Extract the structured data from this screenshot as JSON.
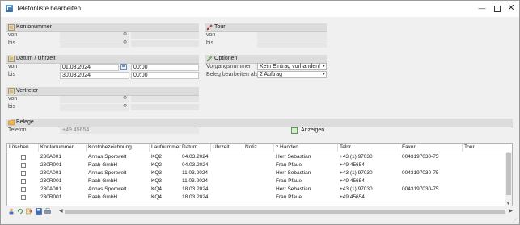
{
  "window": {
    "title": "Telefonliste bearbeiten",
    "min": "—",
    "close": "✕"
  },
  "groups": {
    "kontonummer": {
      "title": "Kontonummer",
      "von": "von",
      "bis": "bis"
    },
    "tour": {
      "title": "Tour",
      "von": "von",
      "bis": "bis"
    },
    "datum": {
      "title": "Datum / Uhrzeit",
      "von": "von",
      "bis": "bis",
      "von_date": "01.03.2024",
      "von_time": "00:00",
      "bis_date": "30.03.2024",
      "bis_time": "00:00"
    },
    "optionen": {
      "title": "Optionen",
      "vorgang_label": "Vorgangsnummer",
      "vorgang_value": "Kein Eintrag vorhanden!",
      "beleg_label": "Beleg bearbeiten als",
      "beleg_value": "2 Auftrag"
    },
    "vertreter": {
      "title": "Vertreter",
      "von": "von",
      "bis": "bis"
    },
    "belege": {
      "title": "Belege",
      "telefon_label": "Telefon",
      "telefon_value": "+49 45654"
    }
  },
  "anzeigen_label": "Anzeigen",
  "table": {
    "columns": [
      "Löschen",
      "Kontonummer",
      "Kontobezeichnung",
      "Laufnummer",
      "Datum",
      "Uhrzeit",
      "Notiz",
      "z.Handen",
      "Telnr.",
      "Faxnr.",
      "Tour"
    ],
    "rows": [
      {
        "konto": "230A001",
        "bez": "Annas Sportwelt",
        "lauf": "KQ2",
        "datum": "04.03.2024",
        "uhrzeit": "",
        "notiz": "",
        "zh": "Herr Sebastian",
        "tel": "+43 (1) 97030",
        "fax": "0043197030-75",
        "tour": ""
      },
      {
        "konto": "230R001",
        "bez": "Raab GmbH",
        "lauf": "KQ2",
        "datum": "04.03.2024",
        "uhrzeit": "",
        "notiz": "",
        "zh": "Frau Pfaue",
        "tel": "+49 45654",
        "fax": "",
        "tour": ""
      },
      {
        "konto": "230A001",
        "bez": "Annas Sportwelt",
        "lauf": "KQ3",
        "datum": "11.03.2024",
        "uhrzeit": "",
        "notiz": "",
        "zh": "Herr Sebastian",
        "tel": "+43 (1) 97030",
        "fax": "0043197030-75",
        "tour": ""
      },
      {
        "konto": "230R001",
        "bez": "Raab GmbH",
        "lauf": "KQ3",
        "datum": "11.03.2024",
        "uhrzeit": "",
        "notiz": "",
        "zh": "Frau Pfaue",
        "tel": "+49 45654",
        "fax": "",
        "tour": ""
      },
      {
        "konto": "230A001",
        "bez": "Annas Sportwelt",
        "lauf": "KQ4",
        "datum": "18.03.2024",
        "uhrzeit": "",
        "notiz": "",
        "zh": "Herr Sebastian",
        "tel": "+43 (1) 97030",
        "fax": "0043197030-75",
        "tour": ""
      },
      {
        "konto": "230R001",
        "bez": "Raab GmbH",
        "lauf": "KQ4",
        "datum": "18.03.2024",
        "uhrzeit": "",
        "notiz": "",
        "zh": "Frau Pfaue",
        "tel": "+49 45654",
        "fax": "",
        "tour": ""
      }
    ]
  },
  "colors": {
    "header_gray": "#dcdcdc",
    "field_gray": "#e4e4e4",
    "accent_blue": "#2e6cb0"
  },
  "icons": [
    "app-icon",
    "magnifier-icon",
    "calendar-icon",
    "book-icon",
    "tool-icon",
    "pencil-icon",
    "folder-icon",
    "person-icon",
    "refresh-icon",
    "save-icon",
    "print-icon",
    "export-icon"
  ]
}
